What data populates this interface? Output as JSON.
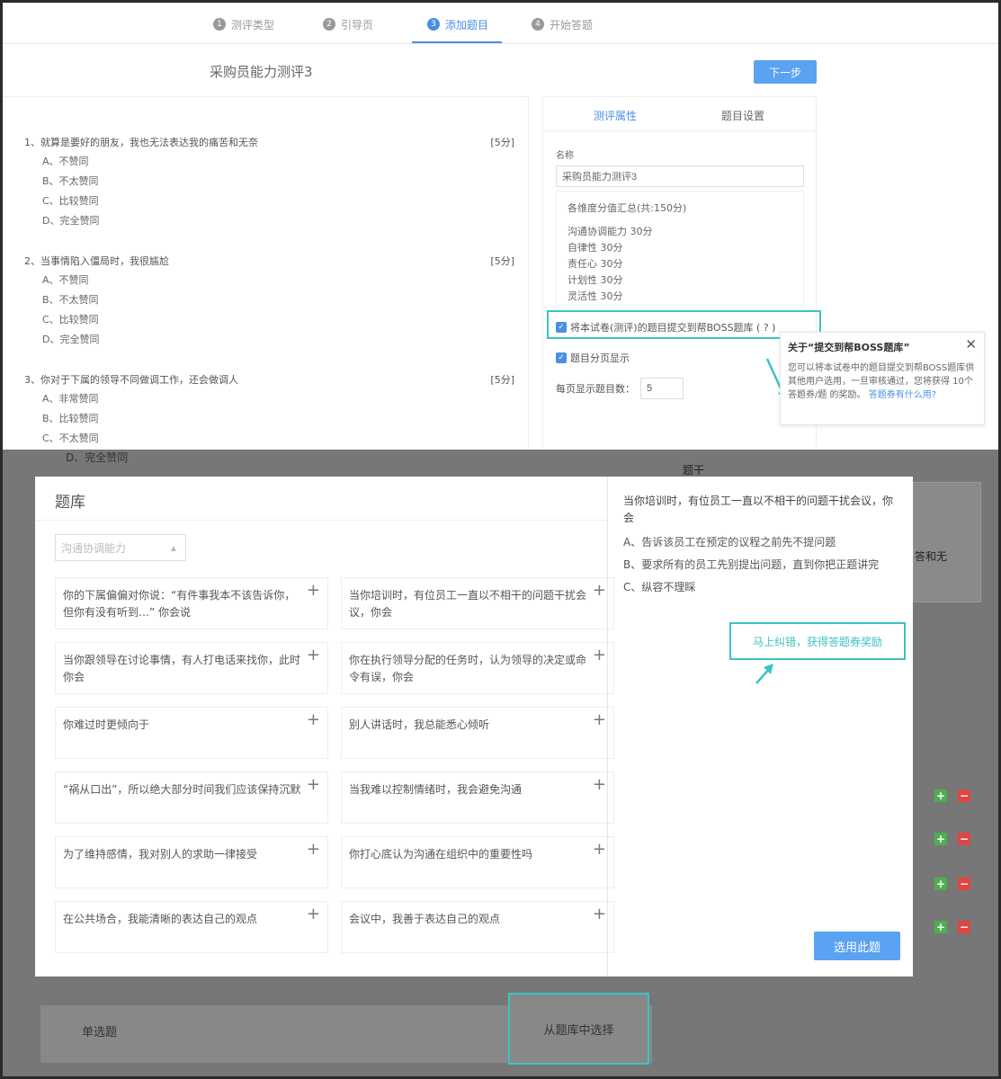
{
  "steps": [
    {
      "num": "1",
      "label": "测评类型"
    },
    {
      "num": "2",
      "label": "引导页"
    },
    {
      "num": "3",
      "label": "添加题目"
    },
    {
      "num": "4",
      "label": "开始答题"
    }
  ],
  "header": {
    "title": "采购员能力测评3",
    "next_label": "下一步"
  },
  "questions": [
    {
      "text": "1、就算是要好的朋友，我也无法表达我的痛苦和无奈",
      "score": "[5分]",
      "options": [
        "A、不赞同",
        "B、不太赞同",
        "C、比较赞同",
        "D、完全赞同"
      ]
    },
    {
      "text": "2、当事情陷入僵局时，我很尴尬",
      "score": "[5分]",
      "options": [
        "A、不赞同",
        "B、不太赞同",
        "C、比较赞同",
        "D、完全赞同"
      ]
    },
    {
      "text": "3、你对于下属的领导不同做调工作，还会做调人",
      "score": "[5分]",
      "options": [
        "A、非常赞同",
        "B、比较赞同",
        "C、不太赞同"
      ]
    }
  ],
  "right_panel": {
    "tab_props": "测评属性",
    "tab_settings": "题目设置",
    "name_label": "名称",
    "name_value": "采购员能力测评3",
    "summary_title": "各维度分值汇总(共:150分)",
    "summary_items": [
      "沟通协调能力 30分",
      "自律性 30分",
      "责任心 30分",
      "计划性 30分",
      "灵活性 30分"
    ],
    "submit_checkbox": "将本试卷(测评)的题目提交到帮BOSS题库 ( ? )",
    "paging_checkbox": "题目分页显示",
    "per_page_label": "每页显示题目数：",
    "per_page_value": "5"
  },
  "tooltip": {
    "title": "关于“提交到帮BOSS题库”",
    "close": "✕",
    "body": "您可以将本试卷中的题目提交到帮BOSS题库供其他用户选用，一旦审核通过，您将获得 10个答题券/题 的奖励。",
    "link": "答题券有什么用?"
  },
  "modal": {
    "title": "题库",
    "category": "沟通协调能力",
    "cards": [
      "你的下属偏偏对你说：“有件事我本不该告诉你，但你有没有听到…” 你会说",
      "当你培训时，有位员工一直以不相干的问题干扰会议，你会",
      "当你跟领导在讨论事情，有人打电话来找你，此时你会",
      "你在执行领导分配的任务时，认为领导的决定或命令有误，你会",
      "你难过时更倾向于",
      "别人讲话时，我总能悉心倾听",
      "“祸从口出”，所以绝大部分时间我们应该保持沉默",
      "当我难以控制情绪时，我会避免沟通",
      "为了维持感情，我对别人的求助一律接受",
      "你打心底认为沟通在组织中的重要性吗",
      "在公共场合，我能清晰的表达自己的观点",
      "会议中，我善于表达自己的观点"
    ],
    "preview_question": "当你培训时，有位员工一直以不相干的问题干扰会议，你会",
    "preview_options": [
      "A、告诉该员工在预定的议程之前先不提问题",
      "B、要求所有的员工先别提出问题，直到你把正题讲完",
      "C、纵容不理睬"
    ],
    "correct_link": "马上纠错，获得答题券奖励",
    "use_button": "选用此题"
  },
  "background": {
    "stem_label": "题干",
    "ghost_text": "答和无",
    "ghost_d": "D、完全赞同",
    "single_choice": "单选题",
    "from_bank": "从题库中选择"
  },
  "colors": {
    "accent": "#4a90e2",
    "highlight": "#3ec2c2",
    "button": "#5aa2f2"
  }
}
